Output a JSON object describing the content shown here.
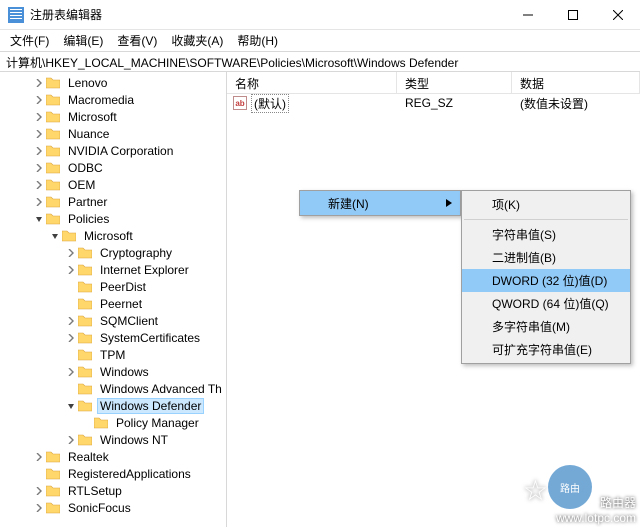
{
  "window": {
    "title": "注册表编辑器"
  },
  "menubar": {
    "file": "文件(F)",
    "edit": "编辑(E)",
    "view": "查看(V)",
    "favorites": "收藏夹(A)",
    "help": "帮助(H)"
  },
  "address": "计算机\\HKEY_LOCAL_MACHINE\\SOFTWARE\\Policies\\Microsoft\\Windows Defender",
  "tree": [
    {
      "indent": 2,
      "chev": "closed",
      "label": "Lenovo"
    },
    {
      "indent": 2,
      "chev": "closed",
      "label": "Macromedia"
    },
    {
      "indent": 2,
      "chev": "closed",
      "label": "Microsoft"
    },
    {
      "indent": 2,
      "chev": "closed",
      "label": "Nuance"
    },
    {
      "indent": 2,
      "chev": "closed",
      "label": "NVIDIA Corporation"
    },
    {
      "indent": 2,
      "chev": "closed",
      "label": "ODBC"
    },
    {
      "indent": 2,
      "chev": "closed",
      "label": "OEM"
    },
    {
      "indent": 2,
      "chev": "closed",
      "label": "Partner"
    },
    {
      "indent": 2,
      "chev": "open",
      "label": "Policies"
    },
    {
      "indent": 3,
      "chev": "open",
      "label": "Microsoft"
    },
    {
      "indent": 4,
      "chev": "closed",
      "label": "Cryptography"
    },
    {
      "indent": 4,
      "chev": "closed",
      "label": "Internet Explorer"
    },
    {
      "indent": 4,
      "chev": "none",
      "label": "PeerDist"
    },
    {
      "indent": 4,
      "chev": "none",
      "label": "Peernet"
    },
    {
      "indent": 4,
      "chev": "closed",
      "label": "SQMClient"
    },
    {
      "indent": 4,
      "chev": "closed",
      "label": "SystemCertificates"
    },
    {
      "indent": 4,
      "chev": "none",
      "label": "TPM"
    },
    {
      "indent": 4,
      "chev": "closed",
      "label": "Windows"
    },
    {
      "indent": 4,
      "chev": "none",
      "label": "Windows Advanced Th"
    },
    {
      "indent": 4,
      "chev": "open",
      "label": "Windows Defender",
      "selected": true
    },
    {
      "indent": 5,
      "chev": "none",
      "label": "Policy Manager"
    },
    {
      "indent": 4,
      "chev": "closed",
      "label": "Windows NT"
    },
    {
      "indent": 2,
      "chev": "closed",
      "label": "Realtek"
    },
    {
      "indent": 2,
      "chev": "none",
      "label": "RegisteredApplications"
    },
    {
      "indent": 2,
      "chev": "closed",
      "label": "RTLSetup"
    },
    {
      "indent": 2,
      "chev": "closed",
      "label": "SonicFocus"
    }
  ],
  "list": {
    "headers": {
      "name": "名称",
      "type": "类型",
      "data": "数据"
    },
    "rows": [
      {
        "icon": "ab",
        "name": "(默认)",
        "type": "REG_SZ",
        "data": "(数值未设置)"
      }
    ]
  },
  "contextMenu": {
    "new": "新建(N)",
    "submenu": [
      {
        "label": "项(K)",
        "sepAfter": true
      },
      {
        "label": "字符串值(S)"
      },
      {
        "label": "二进制值(B)"
      },
      {
        "label": "DWORD (32 位)值(D)",
        "highlight": true
      },
      {
        "label": "QWORD (64 位)值(Q)"
      },
      {
        "label": "多字符串值(M)"
      },
      {
        "label": "可扩充字符串值(E)"
      }
    ]
  },
  "watermark": {
    "line1": "路由器",
    "line2": "www.lotpc.com",
    "badge": "路由"
  }
}
